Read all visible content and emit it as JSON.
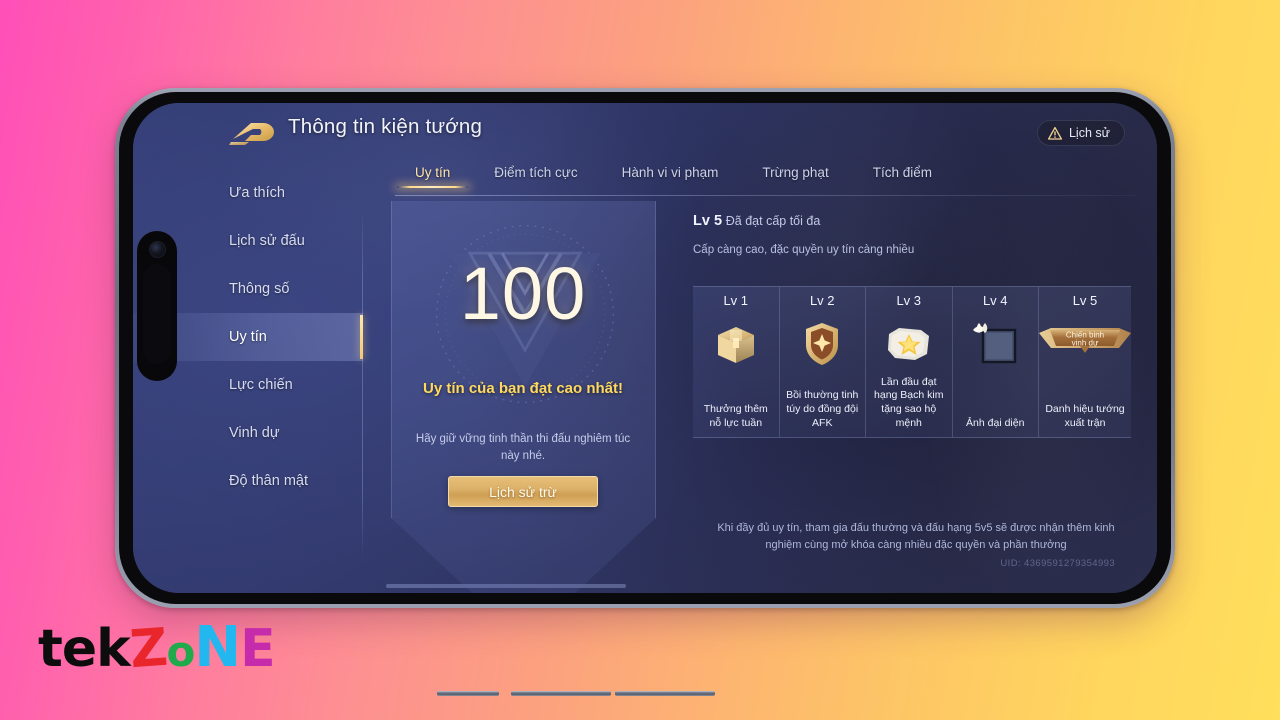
{
  "header": {
    "app_title": "Thông tin kiện tướng",
    "logo_icon": "honor-of-kings-logo-icon",
    "history_button": {
      "label": "Lịch sử",
      "icon": "warning-triangle-icon"
    }
  },
  "tabs": [
    {
      "label": "Uy tín",
      "active": true
    },
    {
      "label": "Điểm tích cực",
      "active": false
    },
    {
      "label": "Hành vi vi phạm",
      "active": false
    },
    {
      "label": "Trừng phạt",
      "active": false
    },
    {
      "label": "Tích điểm",
      "active": false
    }
  ],
  "sidebar": {
    "items": [
      {
        "label": "Ưa thích",
        "active": false
      },
      {
        "label": "Lịch sử đấu",
        "active": false
      },
      {
        "label": "Thông số",
        "active": false
      },
      {
        "label": "Uy tín",
        "active": true
      },
      {
        "label": "Lực chiến",
        "active": false
      },
      {
        "label": "Vinh dự",
        "active": false
      },
      {
        "label": "Độ thân mật",
        "active": false
      }
    ]
  },
  "credit_panel": {
    "score": "100",
    "status_headline": "Uy tín của bạn đạt cao nhất!",
    "status_sub": "Hãy giữ vững tinh thần thi đấu nghiêm túc này nhé.",
    "deduct_button_label": "Lịch sử trừ",
    "crest_icon": "triangle-crest-emblem-icon"
  },
  "level_panel": {
    "level_number": "Lv 5",
    "level_status": "Đã đạt cấp tối đa",
    "level_description": "Cấp càng cao, đặc quyền uy tín càng nhiều",
    "levels": [
      {
        "title": "Lv 1",
        "reward": "Thưởng thêm nỗ lực tuần",
        "icon": "treasure-chest-icon"
      },
      {
        "title": "Lv 2",
        "reward": "Bồi thường tinh túy do đồng đội AFK",
        "icon": "shield-badge-icon"
      },
      {
        "title": "Lv 3",
        "reward": "Lần đầu đạt hạng Bạch kim tặng sao hộ mệnh",
        "icon": "star-scroll-icon"
      },
      {
        "title": "Lv 4",
        "reward": "Ảnh đại diện",
        "icon": "avatar-frame-icon"
      },
      {
        "title": "Lv 5",
        "reward": "Danh hiệu tướng xuất trận",
        "icon": "honor-banner-icon",
        "banner_text_line1": "Chiến binh",
        "banner_text_line2": "vinh dự"
      }
    ],
    "footer_note": "Khi  đầy đủ uy tín, tham gia đấu thường và đấu hạng 5v5 sẽ được nhận thêm kinh nghiệm cùng mở khóa càng nhiều đặc quyền và phần thưởng",
    "uid": "UID: 4369591279354993"
  },
  "watermark": {
    "part_tek": "tek",
    "part_z": "Z",
    "part_o": "o",
    "part_n": "N",
    "part_e": "E"
  },
  "colors": {
    "accent_gold": "#ffd95e",
    "panel_blue": "#343d74",
    "backdrop_pink": "#ff4fb8",
    "backdrop_yellow": "#ffdf5c"
  }
}
